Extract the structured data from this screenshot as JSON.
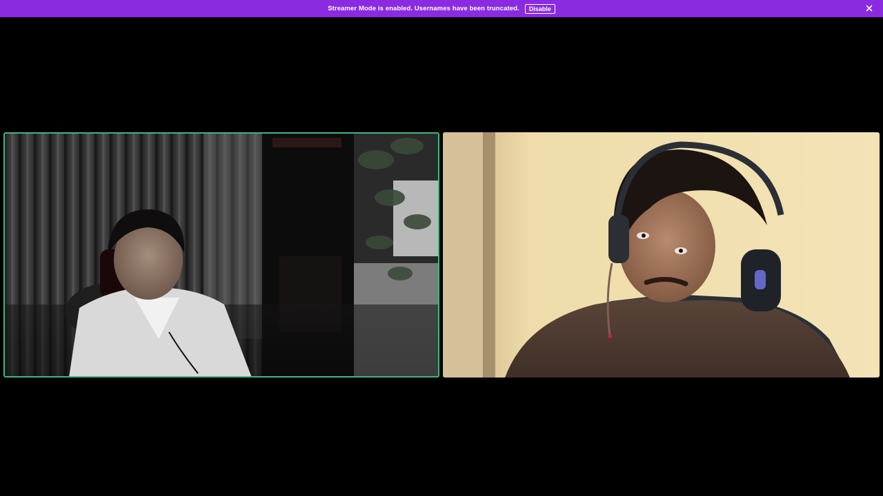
{
  "banner": {
    "text": "Streamer Mode is enabled. Usernames have been truncated.",
    "button_label": "Disable",
    "background_color": "#8a2be2",
    "close_icon": "close-icon"
  },
  "call": {
    "tiles": [
      {
        "id": "participant-1",
        "speaking": true,
        "speaking_border_color": "#43b581",
        "content": "webcam-video"
      },
      {
        "id": "participant-2",
        "speaking": false,
        "content": "webcam-video"
      }
    ]
  }
}
